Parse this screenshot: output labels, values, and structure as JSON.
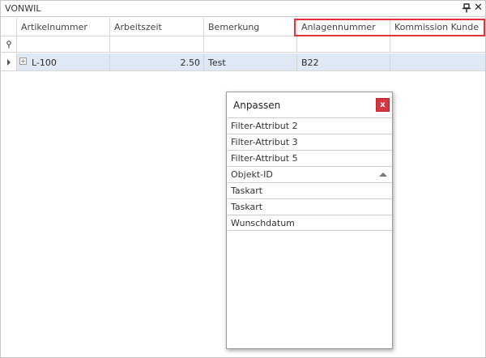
{
  "window": {
    "title": "VONWIL"
  },
  "grid": {
    "filter_icon": "pin-icon",
    "columns": [
      "Artikelnummer",
      "Arbeitszeit",
      "Bemerkung",
      "Anlagennummer",
      "Kommission Kunde"
    ],
    "rows": [
      {
        "artikelnummer": "L-100",
        "arbeitszeit": "2.50",
        "bemerkung": "Test",
        "anlagennummer": "B22",
        "kommission_kunde": ""
      }
    ]
  },
  "customize": {
    "title": "Anpassen",
    "close_label": "x",
    "items": [
      "Filter-Attribut 2",
      "Filter-Attribut 3",
      "Filter-Attribut 5",
      "Objekt-ID",
      "Taskart",
      "Taskart",
      "Wunschdatum"
    ]
  },
  "colors": {
    "highlight": "#e0343d",
    "selected_row": "#dfe9f5",
    "close_button": "#d6363f"
  }
}
